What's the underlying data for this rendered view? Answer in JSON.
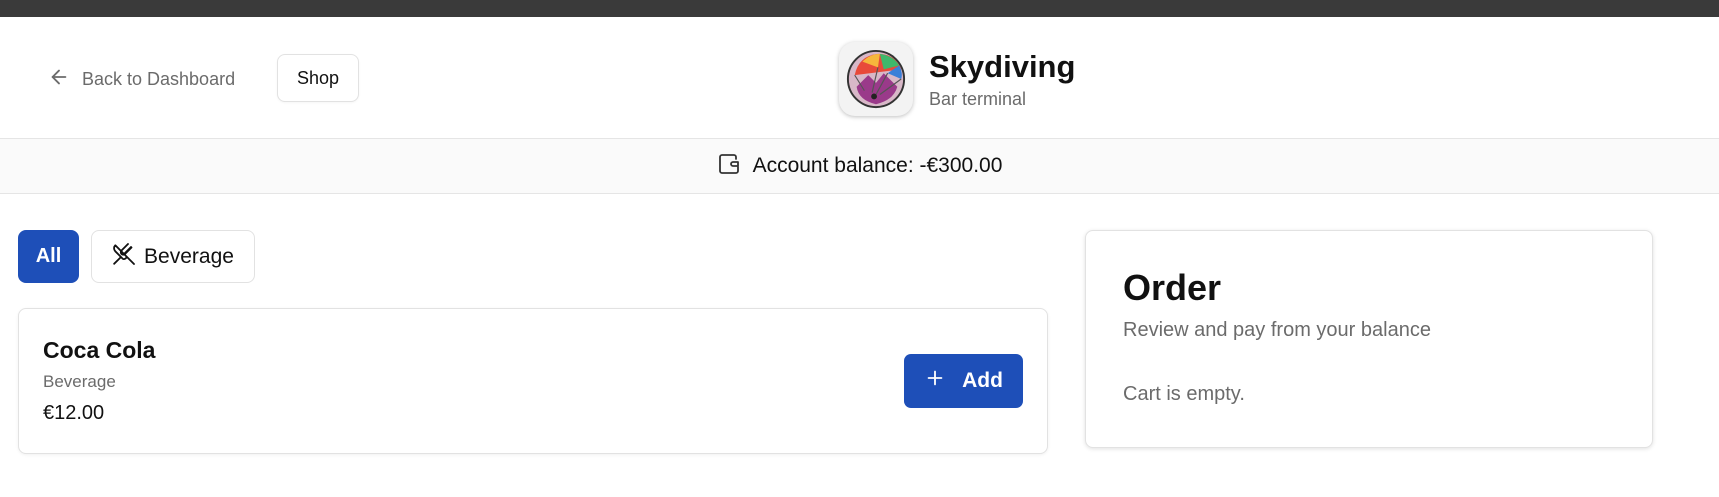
{
  "header": {
    "back_label": "Back to Dashboard",
    "shop_label": "Shop",
    "app_title": "Skydiving",
    "app_subtitle": "Bar terminal",
    "logo_icon": "parachute-logo"
  },
  "balance": {
    "label": "Account balance: -€300.00",
    "icon": "wallet-icon"
  },
  "filters": {
    "all_label": "All",
    "beverage_label": "Beverage"
  },
  "products": [
    {
      "name": "Coca Cola",
      "category": "Beverage",
      "price": "€12.00",
      "add_label": "Add"
    }
  ],
  "order": {
    "title": "Order",
    "subtitle": "Review and pay from your balance",
    "empty_text": "Cart is empty."
  },
  "colors": {
    "accent": "#1e4fb8",
    "topbar": "#3a3a3a",
    "muted_text": "#6b6b6b"
  }
}
